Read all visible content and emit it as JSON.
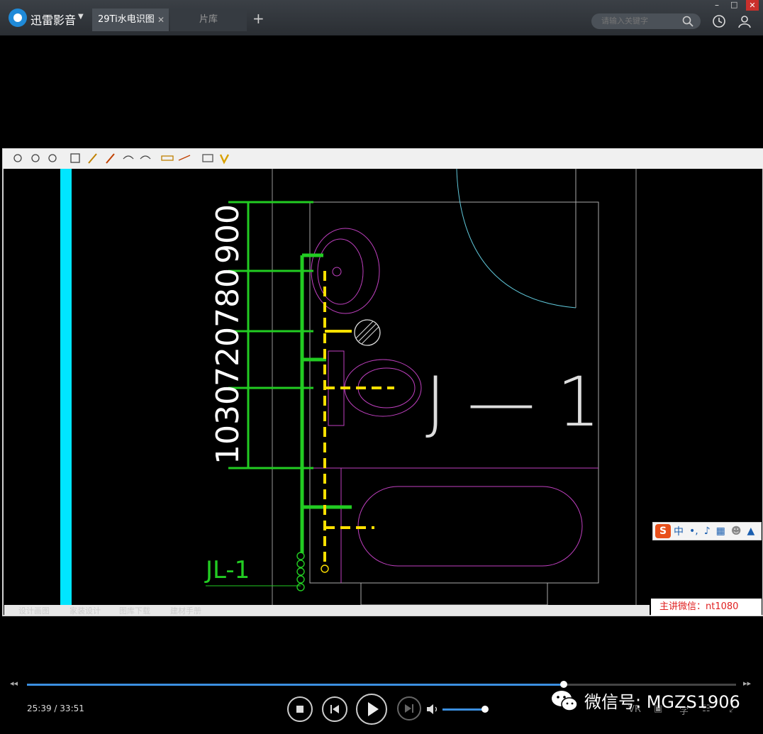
{
  "app": {
    "name": "迅雷影音",
    "search_placeholder": "请输入关键字",
    "colors": {
      "titlebar": "#2f3338",
      "accent": "#3b8fe0",
      "close": "#c9302c"
    }
  },
  "tabs": [
    {
      "label": "29Ti水电识图",
      "active": true
    },
    {
      "label": "片库",
      "active": false
    }
  ],
  "window_controls": {
    "minimize": "–",
    "maximize": "□",
    "close": "✕"
  },
  "video": {
    "cad_toolbar_icons": [
      "pan-icon",
      "zoom-in-icon",
      "zoom-window-icon",
      "zoom-extents-icon",
      "text-icon",
      "pencil-icon",
      "highlighter-icon",
      "undo-icon",
      "redo-icon",
      "measure-icon",
      "hatch-icon",
      "layers-icon",
      "v-icon"
    ],
    "dimensions": [
      "1030",
      "720",
      "780",
      "900"
    ],
    "riser_label": "JL-1",
    "handwritten_label": "J — 1",
    "bottom_tabs": [
      "设计画图",
      "家装设计",
      "图库下载",
      "建材手册"
    ],
    "ime_bar": {
      "logo": "S",
      "mode": "中"
    },
    "wechat_box": "主讲微信：nt1080"
  },
  "player": {
    "time_current": "25:39",
    "time_total": "33:51",
    "time_separator": "/",
    "progress": 0.757,
    "volume": 1.0,
    "vr_label": "VR",
    "skip_back": "◂◂",
    "skip_forward": "▸▸"
  },
  "watermark": {
    "text": "微信号: MGZS1906"
  }
}
